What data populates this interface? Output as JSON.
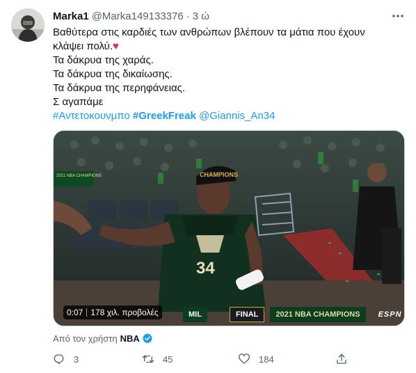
{
  "tweet": {
    "author": {
      "display_name": "Marka1",
      "handle": "@Marka149133376",
      "separator": "·",
      "time": "3 ώ"
    },
    "text_lines": [
      "Βαθύτερα στις καρδιές των ανθρώπων βλέπουν τα μάτια που έχουν",
      "κλάψει πολύ.",
      "Τα δάκρυα της χαράς.",
      "Τα δάκρυα της δικαίωσης.",
      "Τα δάκρυα της περηφάνειας.",
      "Σ αγαπάμε"
    ],
    "heart_emoji": "♥",
    "hashtags": [
      "#Αντετοκουνμπο",
      "#GreekFreak"
    ],
    "mention": "@Giannis_An34",
    "media": {
      "time": "0:07",
      "views": "178 χιλ. προβολές",
      "scorebug": {
        "team": "MIL",
        "status": "FINAL",
        "banner": "2021 NBA CHAMPIONS",
        "network": "ESPN",
        "cap_text": "CHAMPIONS",
        "jersey_number": "34",
        "board_text": "2021 NBA CHAMPIONS"
      }
    },
    "attribution": {
      "prefix": "Από τον χρήστη",
      "user": "NBA"
    },
    "actions": {
      "reply_count": "3",
      "retweet_count": "45",
      "like_count": "184"
    }
  },
  "icons": {
    "more": "more-dots-icon",
    "reply": "reply-icon",
    "retweet": "retweet-icon",
    "like": "heart-icon",
    "share": "share-icon",
    "verified": "verified-badge-icon"
  },
  "colors": {
    "link": "#1d9bf0",
    "text": "#0f1419",
    "muted": "#536471",
    "heart": "#e0245e"
  }
}
